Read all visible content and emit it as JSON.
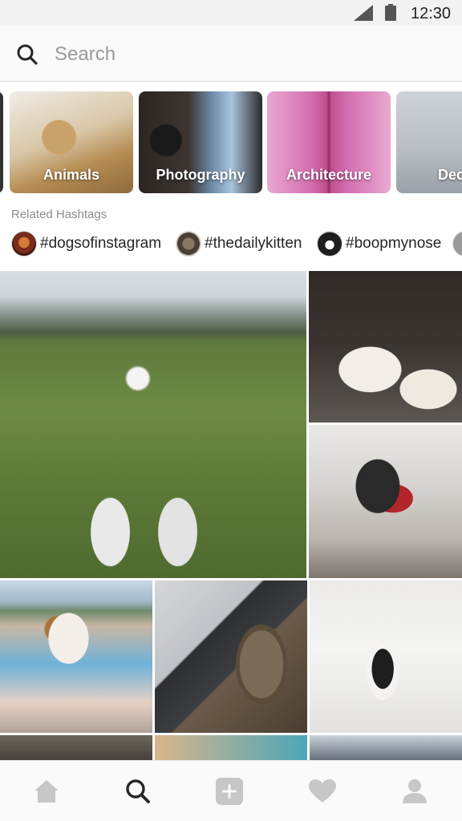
{
  "status_bar": {
    "time": "12:30",
    "signal_icon": "signal-icon",
    "battery_icon": "battery-icon"
  },
  "search": {
    "placeholder": "Search",
    "icon": "search-icon"
  },
  "categories": [
    {
      "label": ""
    },
    {
      "label": "Animals"
    },
    {
      "label": "Photography"
    },
    {
      "label": "Architecture"
    },
    {
      "label": "Dec"
    }
  ],
  "related_hashtags": {
    "title": "Related Hashtags",
    "items": [
      {
        "tag": "#dogsofinstagram"
      },
      {
        "tag": "#thedailykitten"
      },
      {
        "tag": "#boopmynose"
      },
      {
        "tag": ""
      }
    ]
  },
  "grid": {
    "items": [
      {
        "name": "dog-on-grass-photo"
      },
      {
        "name": "bunny-photo"
      },
      {
        "name": "dog-in-snow-photo"
      },
      {
        "name": "dog-on-graffiti-photo"
      },
      {
        "name": "cat-with-laptop-photo"
      },
      {
        "name": "dog-on-bed-photo"
      }
    ]
  },
  "bottom_nav": {
    "items": [
      {
        "icon": "home-icon",
        "active": false
      },
      {
        "icon": "search-icon",
        "active": true
      },
      {
        "icon": "add-icon",
        "active": false
      },
      {
        "icon": "heart-icon",
        "active": false
      },
      {
        "icon": "profile-icon",
        "active": false
      }
    ]
  },
  "colors": {
    "active_icon": "#262626",
    "inactive_icon": "#c7c7c7",
    "secondary_text": "#8e8e8e"
  }
}
